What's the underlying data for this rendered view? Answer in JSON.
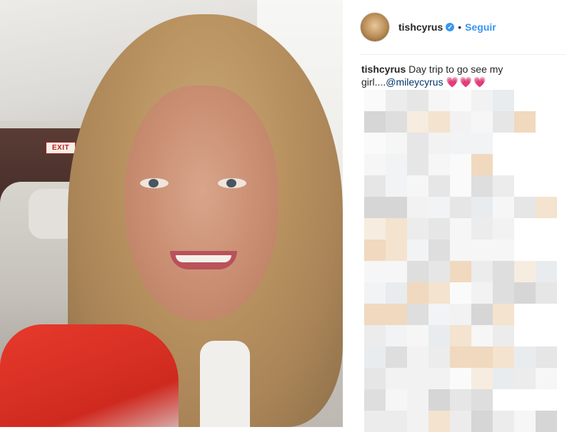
{
  "post": {
    "username": "tishcyrus",
    "verified_icon": "verified-badge-icon",
    "separator": "•",
    "follow_label": "Seguir",
    "caption_user": "tishcyrus",
    "caption_text": "Day trip to go see my girl....",
    "mention": "@mileycyrus",
    "hearts": "💗💗💗"
  },
  "photo": {
    "exit_sign": "EXIT"
  },
  "colors": {
    "accent_blue": "#3897f0",
    "mention_blue": "#003569",
    "text_dark": "#262626"
  }
}
